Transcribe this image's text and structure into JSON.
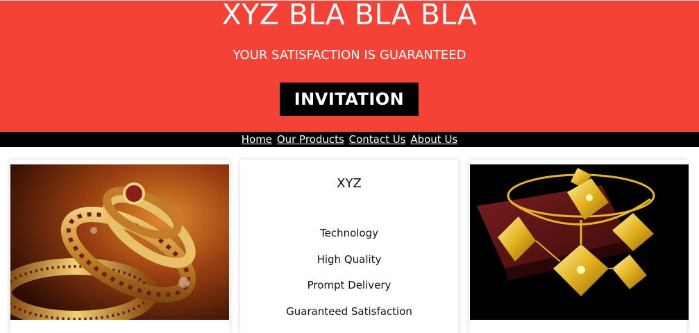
{
  "hero": {
    "title": "XYZ BLA BLA BLA",
    "subtitle": "YOUR SATISFACTION IS GUARANTEED",
    "cta_label": "INVITATION",
    "background_color": "#f44336"
  },
  "nav": {
    "items": [
      {
        "label": "Home"
      },
      {
        "label": "Our Products"
      },
      {
        "label": "Contact Us"
      },
      {
        "label": "About Us"
      }
    ]
  },
  "cards": {
    "left": {
      "image": "gold-bangles-photo"
    },
    "middle": {
      "title": "XYZ",
      "features": [
        "Technology",
        "High Quality",
        "Prompt Delivery",
        "Guaranteed Satisfaction"
      ]
    },
    "right": {
      "image": "gold-necklace-set-photo"
    }
  }
}
